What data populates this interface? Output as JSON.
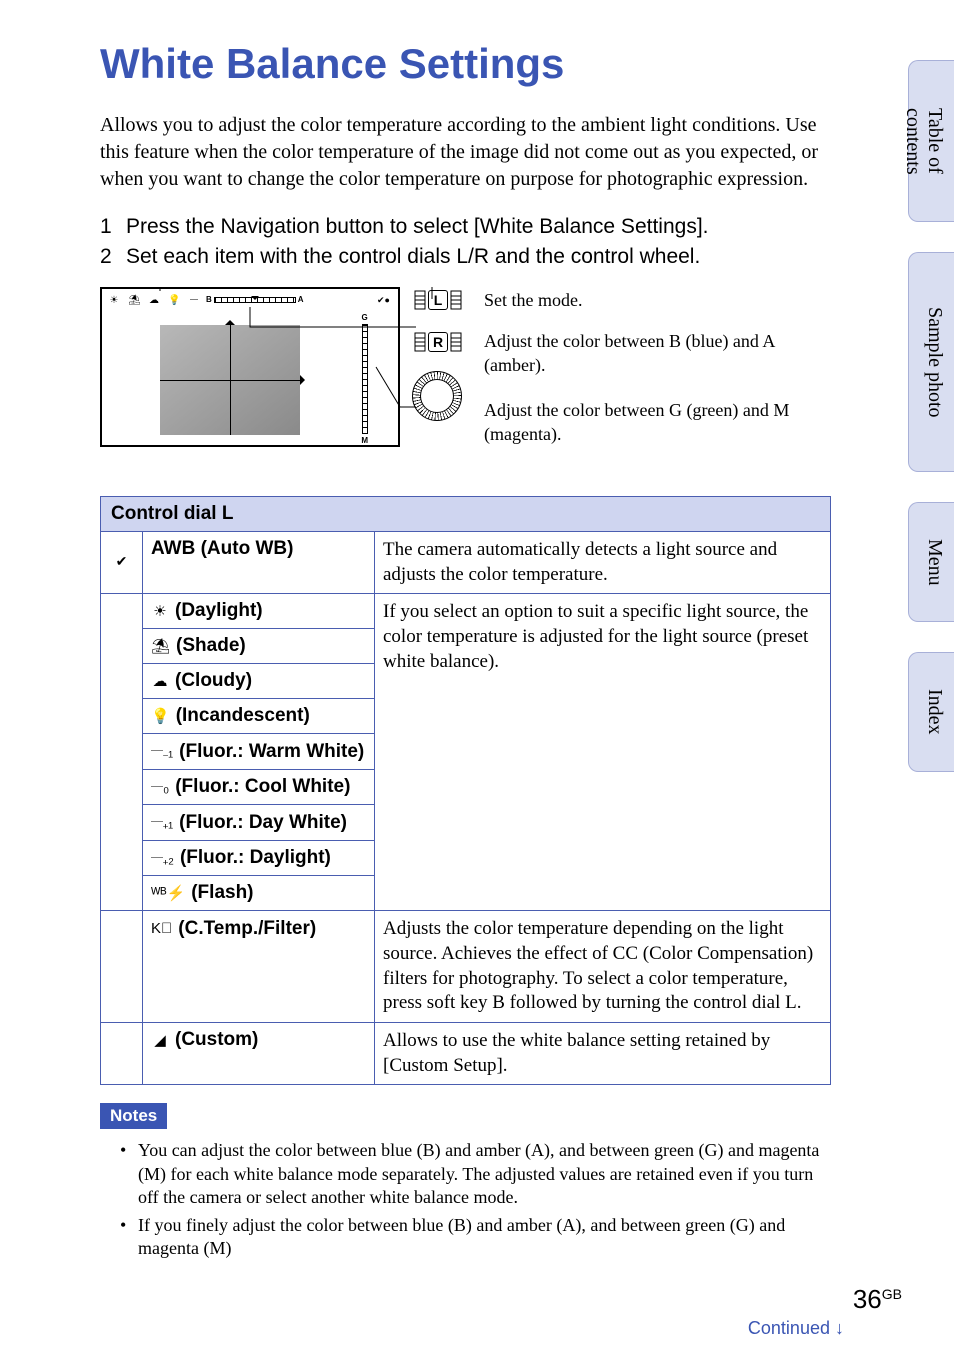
{
  "title": "White Balance Settings",
  "intro": "Allows you to adjust the color temperature according to the ambient light conditions. Use this feature when the color temperature of the image did not come out as you expected, or when you want to change the color temperature on purpose for photographic expression.",
  "steps": [
    {
      "num": "1",
      "text": "Press the Navigation button to select [White Balance Settings]."
    },
    {
      "num": "2",
      "text": "Set each item with the control dials L/R and the control wheel."
    }
  ],
  "diagram_labels": {
    "L": "Set the mode.",
    "R": "Adjust the color between B (blue) and A (amber).",
    "wheel": "Adjust the color between G (green) and M (magenta)."
  },
  "diagram_axis": {
    "b": "B",
    "a": "A",
    "g": "G",
    "m": "M"
  },
  "dial_letters": {
    "L": "L",
    "R": "R"
  },
  "table_header": "Control dial L",
  "rows": {
    "awb": {
      "label": "AWB (Auto WB)",
      "desc": "The camera automatically detects a light source and adjusts the color temperature."
    },
    "preset_desc": "If you select an option to suit a specific light source, the color temperature is adjusted for the light source (preset white balance).",
    "daylight": {
      "label": "(Daylight)"
    },
    "shade": {
      "label": "(Shade)"
    },
    "cloudy": {
      "label": "(Cloudy)"
    },
    "incandescent": {
      "label": "(Incandescent)"
    },
    "fluor_warm": {
      "label": "(Fluor.: Warm White)"
    },
    "fluor_cool": {
      "label": "(Fluor.: Cool White)"
    },
    "fluor_daywhite": {
      "label": "(Fluor.: Day White)"
    },
    "fluor_daylight": {
      "label": "(Fluor.: Daylight)"
    },
    "flash": {
      "label": "(Flash)"
    },
    "ctemp": {
      "label": "(C.Temp./Filter)",
      "desc": "Adjusts the color temperature depending on the light source. Achieves the effect of CC (Color Compensation) filters for photography. To select a color temperature, press soft key B followed by turning the control dial L."
    },
    "custom": {
      "label": "(Custom)",
      "desc": "Allows to use the white balance setting retained by [Custom Setup]."
    }
  },
  "icons": {
    "awb": "✔",
    "daylight": "☀",
    "shade": "⛱",
    "cloudy": "☁",
    "incandescent": "💡",
    "fluor_warm": "𝄖₋₁",
    "fluor_cool": "𝄖₀",
    "fluor_daywhite": "𝄖₊₁",
    "fluor_daylight": "𝄖₊₂",
    "flash": "ᵂᴮ⚡",
    "ctemp": "K⃠",
    "custom": "◢"
  },
  "notes_heading": "Notes",
  "notes": [
    "You can adjust the color between blue (B) and amber (A), and between green (G) and magenta (M) for each white balance mode separately. The adjusted values are retained even if you turn off the camera or select another white balance mode.",
    "If you finely adjust the color between blue (B) and amber (A), and between green (G) and magenta (M)"
  ],
  "page_number": "36",
  "page_region": "GB",
  "continued": "Continued",
  "continued_arrow": "↓",
  "side_tabs": {
    "toc": "Table of contents",
    "sample": "Sample photo",
    "menu": "Menu",
    "index": "Index"
  }
}
